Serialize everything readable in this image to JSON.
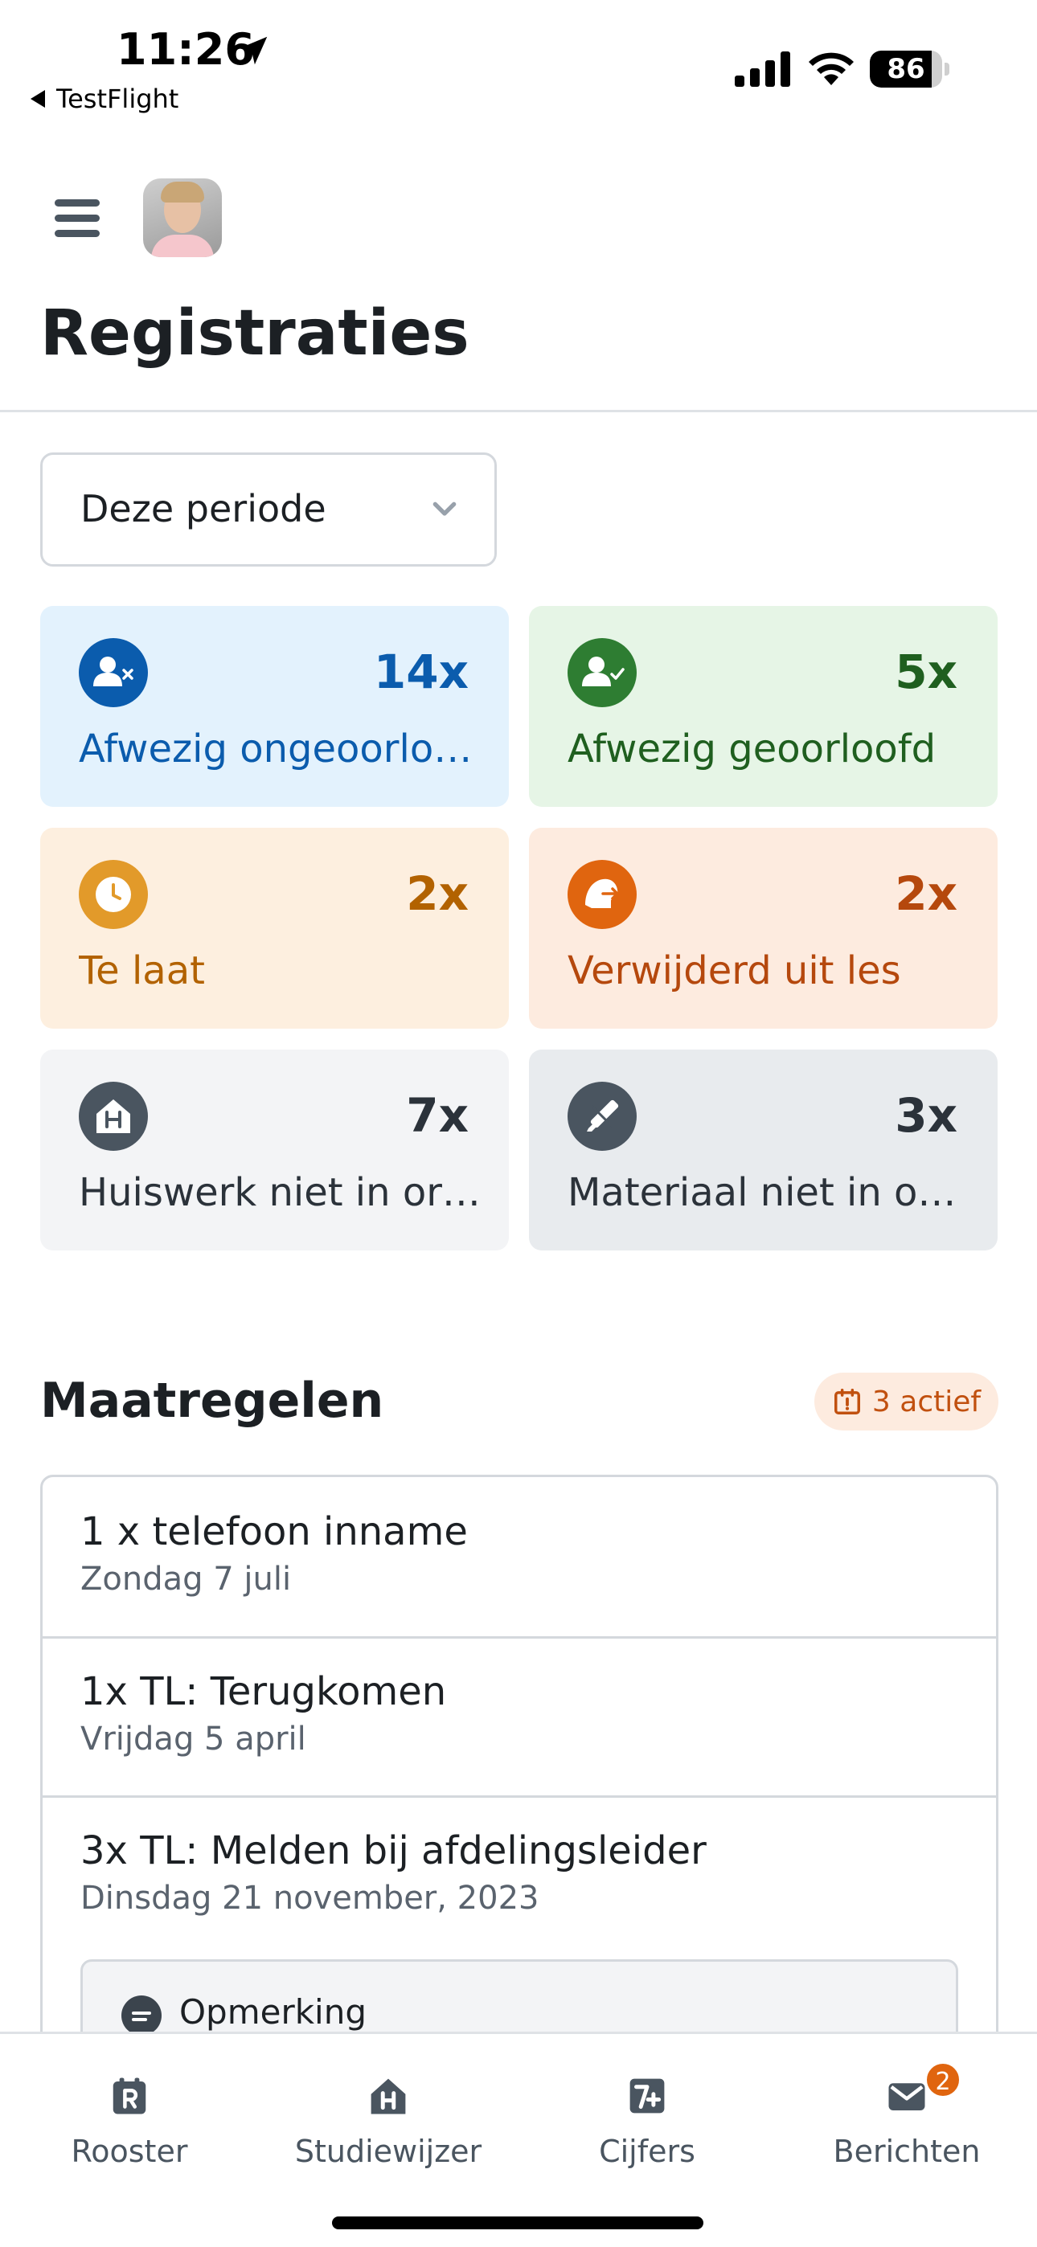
{
  "status_bar": {
    "time": "11:26",
    "back_app": "TestFlight",
    "battery_level": "86",
    "battery_fraction": 0.86
  },
  "header": {
    "title": "Registraties"
  },
  "period_select": {
    "value": "Deze periode"
  },
  "stats": [
    {
      "count": "14x",
      "label": "Afwezig ongeoorlo…",
      "icon": "user-x-icon",
      "bg": "#e3f2fd",
      "color": "#0b5cad",
      "icon_bg": "#0b5cad"
    },
    {
      "count": "5x",
      "label": "Afwezig geoorloofd",
      "icon": "user-check-icon",
      "bg": "#e6f5e6",
      "color": "#1f5f1f",
      "icon_bg": "#2e7d32"
    },
    {
      "count": "2x",
      "label": "Te laat",
      "icon": "clock-icon",
      "bg": "#fdefdf",
      "color": "#b26200",
      "icon_bg": "#e29a2a"
    },
    {
      "count": "2x",
      "label": "Verwijderd uit les",
      "icon": "removed-icon",
      "bg": "#fdebdf",
      "color": "#b5480d",
      "icon_bg": "#e0650f"
    },
    {
      "count": "7x",
      "label": "Huiswerk niet in or…",
      "icon": "homework-icon",
      "bg": "#f3f4f6",
      "color": "#2b323a",
      "icon_bg": "#4a5560"
    },
    {
      "count": "3x",
      "label": "Materiaal niet in or…",
      "icon": "material-icon",
      "bg": "#e8ebee",
      "color": "#2b323a",
      "icon_bg": "#4a5560"
    }
  ],
  "measures_section": {
    "title": "Maatregelen",
    "active_badge": "3 actief",
    "items": [
      {
        "title": "1 x telefoon inname",
        "date": "Zondag 7 juli"
      },
      {
        "title": "1x TL: Terugkomen",
        "date": "Vrijdag 5 april"
      },
      {
        "title": "3x TL: Melden bij afdelingsleider",
        "date": "Dinsdag 21 november, 2023"
      }
    ],
    "remark_label": "Opmerking"
  },
  "tabbar": {
    "tabs": [
      {
        "label": "Rooster"
      },
      {
        "label": "Studiewijzer"
      },
      {
        "label": "Cijfers"
      },
      {
        "label": "Berichten",
        "badge": "2"
      }
    ]
  }
}
